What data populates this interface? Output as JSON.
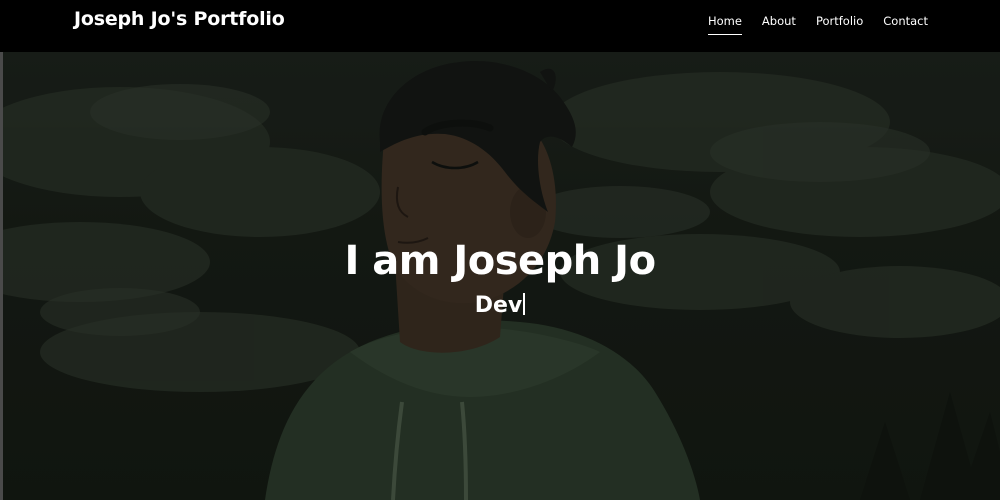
{
  "navbar": {
    "brand": "Joseph Jo's Portfolio",
    "links": [
      {
        "label": "Home",
        "active": true
      },
      {
        "label": "About",
        "active": false
      },
      {
        "label": "Portfolio",
        "active": false
      },
      {
        "label": "Contact",
        "active": false
      }
    ]
  },
  "hero": {
    "title": "I am Joseph Jo",
    "typed_text": "Dev",
    "background_image": "anime-style-portrait-young-man-green-hoodie-eyes-closed-cloudy-sky"
  },
  "colors": {
    "navbar_bg": "#000000",
    "text": "#ffffff",
    "hero_tint": "#1b211a"
  }
}
